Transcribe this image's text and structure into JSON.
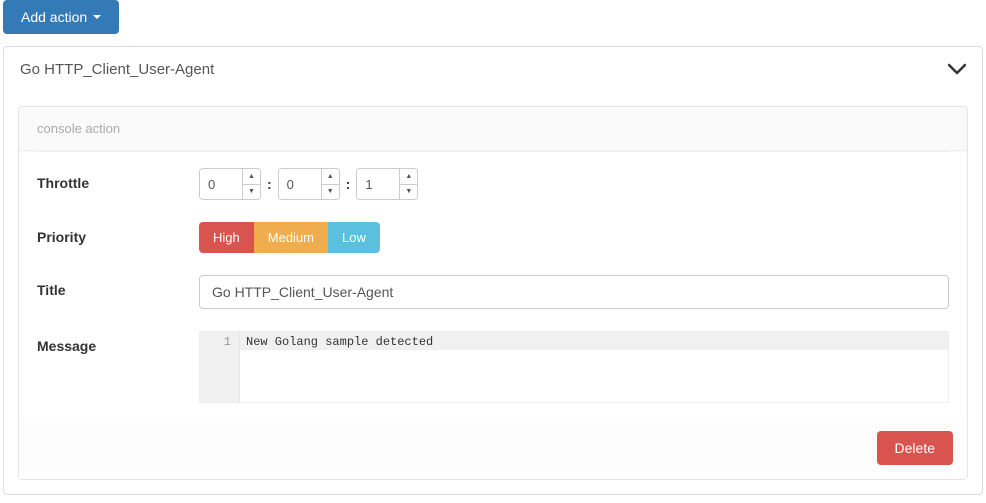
{
  "toolbar": {
    "add_action_label": "Add action"
  },
  "panel": {
    "title": "Go HTTP_Client_User-Agent"
  },
  "action": {
    "header": "console action",
    "labels": {
      "throttle": "Throttle",
      "priority": "Priority",
      "title": "Title",
      "message": "Message"
    },
    "throttle": {
      "h": "0",
      "m": "0",
      "s": "1",
      "sep": ":"
    },
    "priority": {
      "high": "High",
      "medium": "Medium",
      "low": "Low",
      "selected": "High"
    },
    "title_value": "Go HTTP_Client_User-Agent",
    "message": {
      "line_number": "1",
      "line_text": "New Golang sample detected"
    },
    "delete_label": "Delete"
  }
}
